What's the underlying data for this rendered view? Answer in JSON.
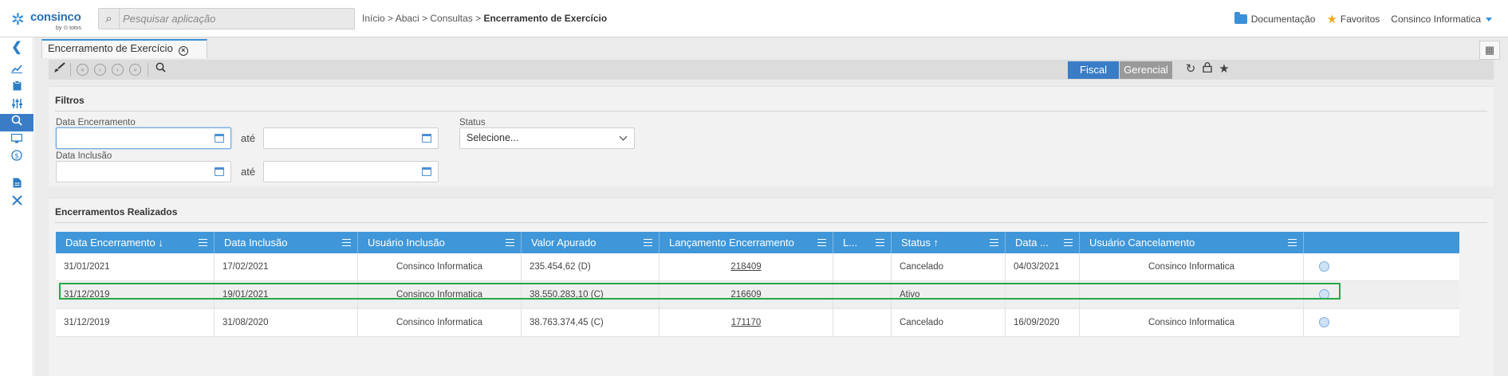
{
  "app": {
    "logo_text": "consinco",
    "logo_sub": "by ⊙ totvs",
    "search_placeholder": "Pesquisar aplicação",
    "breadcrumb_path": "Início > Abaci > Consultas > ",
    "breadcrumb_current": "Encerramento de Exercício",
    "docs_label": "Documentação",
    "favorites_label": "Favoritos",
    "user_label": "Consinco Informatica",
    "icons": {
      "logo": "consinco-logo-icon",
      "search": "search-icon",
      "docs": "folder-icon",
      "favorites": "star-icon",
      "user_menu": "caret-down-icon"
    }
  },
  "sidebar": {
    "items": [
      {
        "name": "collapse-sidebar-icon",
        "glyph": "❮"
      },
      {
        "name": "chart-line-icon",
        "glyph": "📈"
      },
      {
        "name": "clipboard-icon",
        "glyph": "▮"
      },
      {
        "name": "sliders-icon",
        "glyph": "⫶"
      },
      {
        "name": "search-money-icon",
        "glyph": "◎",
        "active": true
      },
      {
        "name": "monitor-icon",
        "glyph": "▣"
      },
      {
        "name": "dollar-icon",
        "glyph": "$"
      },
      {
        "name": "document-icon",
        "glyph": "▤"
      },
      {
        "name": "tools-icon",
        "glyph": "✕"
      }
    ]
  },
  "tab": {
    "label": "Encerramento de Exercício",
    "close_glyph": "×"
  },
  "toolbar": {
    "segment_fiscal": "Fiscal",
    "segment_gerencial": "Gerencial",
    "icons": [
      "brush-icon",
      "first-page-icon",
      "previous-page-icon",
      "next-page-icon",
      "last-page-icon",
      "search-icon",
      "refresh-icon",
      "lock-icon",
      "favorite-star-icon"
    ]
  },
  "filters": {
    "title": "Filtros",
    "data_encerramento_label": "Data Encerramento",
    "data_inclusao_label": "Data Inclusão",
    "ate_label": "até",
    "status_label": "Status",
    "status_value": "Selecione..."
  },
  "grid": {
    "title": "Encerramentos Realizados",
    "columns": [
      {
        "label": "Data Encerramento",
        "sort": "↓"
      },
      {
        "label": "Data Inclusão",
        "sort": ""
      },
      {
        "label": "Usuário Inclusão",
        "sort": ""
      },
      {
        "label": "Valor Apurado",
        "sort": ""
      },
      {
        "label": "Lançamento Encerramento",
        "sort": ""
      },
      {
        "label": "L...",
        "sort": ""
      },
      {
        "label": "Status",
        "sort": "↑"
      },
      {
        "label": "Data ...",
        "sort": ""
      },
      {
        "label": "Usuário Cancelamento",
        "sort": ""
      },
      {
        "label": "",
        "sort": ""
      }
    ],
    "rows": [
      {
        "data_encerramento": "31/01/2021",
        "data_inclusao": "17/02/2021",
        "usuario_inclusao": "Consinco Informatica",
        "valor": "235.454,62 (D)",
        "lancamento": "218409",
        "l": "",
        "status": "Cancelado",
        "data_cancel": "04/03/2021",
        "usuario_cancel": "Consinco Informatica"
      },
      {
        "data_encerramento": "31/12/2019",
        "data_inclusao": "19/01/2021",
        "usuario_inclusao": "Consinco Informatica",
        "valor": "38.550.283,10 (C)",
        "lancamento": "216609",
        "l": "",
        "status": "Ativo",
        "data_cancel": "",
        "usuario_cancel": ""
      },
      {
        "data_encerramento": "31/12/2019",
        "data_inclusao": "31/08/2020",
        "usuario_inclusao": "Consinco Informatica",
        "valor": "38.763.374,45 (C)",
        "lancamento": "171170",
        "l": "",
        "status": "Cancelado",
        "data_cancel": "16/09/2020",
        "usuario_cancel": "Consinco Informatica"
      }
    ]
  },
  "colors": {
    "accent": "#3a7dc6",
    "grid_header": "#3f97d9",
    "highlight": "#28a745",
    "favorite": "#f2a81d"
  }
}
